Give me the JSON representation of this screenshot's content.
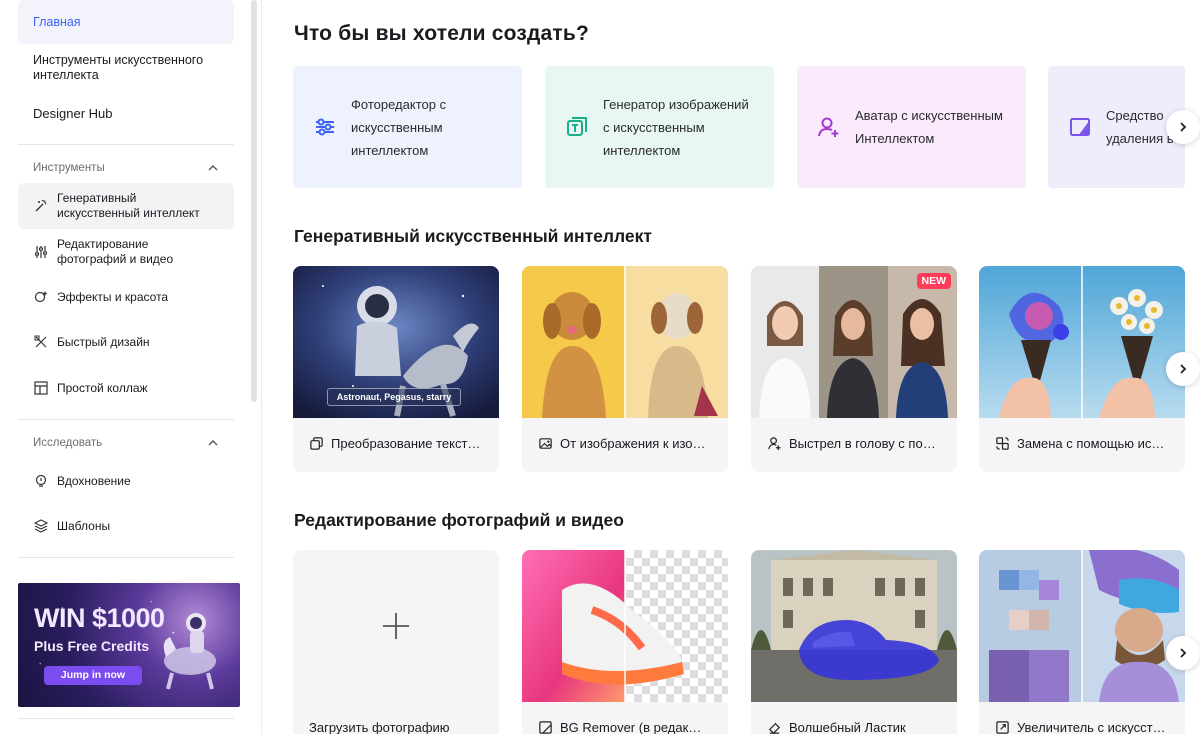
{
  "sidebar": {
    "home": "Главная",
    "ai_tools": "Инструменты искусственного интеллекта",
    "designer_hub": "Designer Hub",
    "tools_header": "Инструменты",
    "tools": [
      {
        "label": "Генеративный искусственный интеллект",
        "icon": "magic-wand-icon"
      },
      {
        "label": "Редактирование фотографий и видео",
        "icon": "sliders-icon"
      },
      {
        "label": "Эффекты и красота",
        "icon": "sparkle-icon"
      },
      {
        "label": "Быстрый дизайн",
        "icon": "design-tools-icon"
      },
      {
        "label": "Простой коллаж",
        "icon": "collage-icon"
      }
    ],
    "explore_header": "Исследовать",
    "explore": [
      {
        "label": "Вдохновение",
        "icon": "lightbulb-icon"
      },
      {
        "label": "Шаблоны",
        "icon": "layers-icon"
      }
    ],
    "promo": {
      "title": "WIN $1000",
      "subtitle": "Plus Free Credits",
      "button": "Jump in now"
    }
  },
  "main": {
    "heading": "Что бы вы хотели создать?",
    "categories": [
      {
        "label": "Фоторедактор с искусственным интеллектом",
        "icon": "sliders-icon",
        "bg": "#eef2fc",
        "color": "#3d63f5"
      },
      {
        "label": "Генератор изображений с искусственным интеллектом",
        "icon": "text-image-icon",
        "bg": "#e8f7f1",
        "color": "#19b089"
      },
      {
        "label": "Аватар с искусственным Интеллектом",
        "icon": "user-plus-icon",
        "bg": "#fbeafb",
        "color": "#a43ad6"
      },
      {
        "label": "Средство удаления в",
        "icon": "eraser-panel-icon",
        "bg": "#efedfb",
        "color": "#7a52ee"
      }
    ],
    "gen_ai_title": "Генеративный искусственный интеллект",
    "gen_ai_cards": [
      {
        "caption": "Преобразование текст…",
        "icon": "copy-icon",
        "overlay_text": "Astronaut, Pegasus, starry"
      },
      {
        "caption": "От изображения к изо…",
        "icon": "image-icon"
      },
      {
        "caption": "Выстрел в голову с по…",
        "icon": "user-plus-icon",
        "badge": "NEW"
      },
      {
        "caption": "Замена с помощью ис…",
        "icon": "swap-icon"
      }
    ],
    "photo_title": "Редактирование фотографий и видео",
    "photo_cards": [
      {
        "caption": "Загрузить фотографию",
        "icon": "plus-icon"
      },
      {
        "caption": "BG Remover (в редак…",
        "icon": "crop-icon"
      },
      {
        "caption": "Волшебный Ластик",
        "icon": "eraser-icon"
      },
      {
        "caption": "Увеличитель с искусст…",
        "icon": "upscale-icon"
      }
    ]
  },
  "colors": {
    "accent": "#3d63f5",
    "badge": "#ff3d5a",
    "promo_button": "#7b4cf0"
  }
}
